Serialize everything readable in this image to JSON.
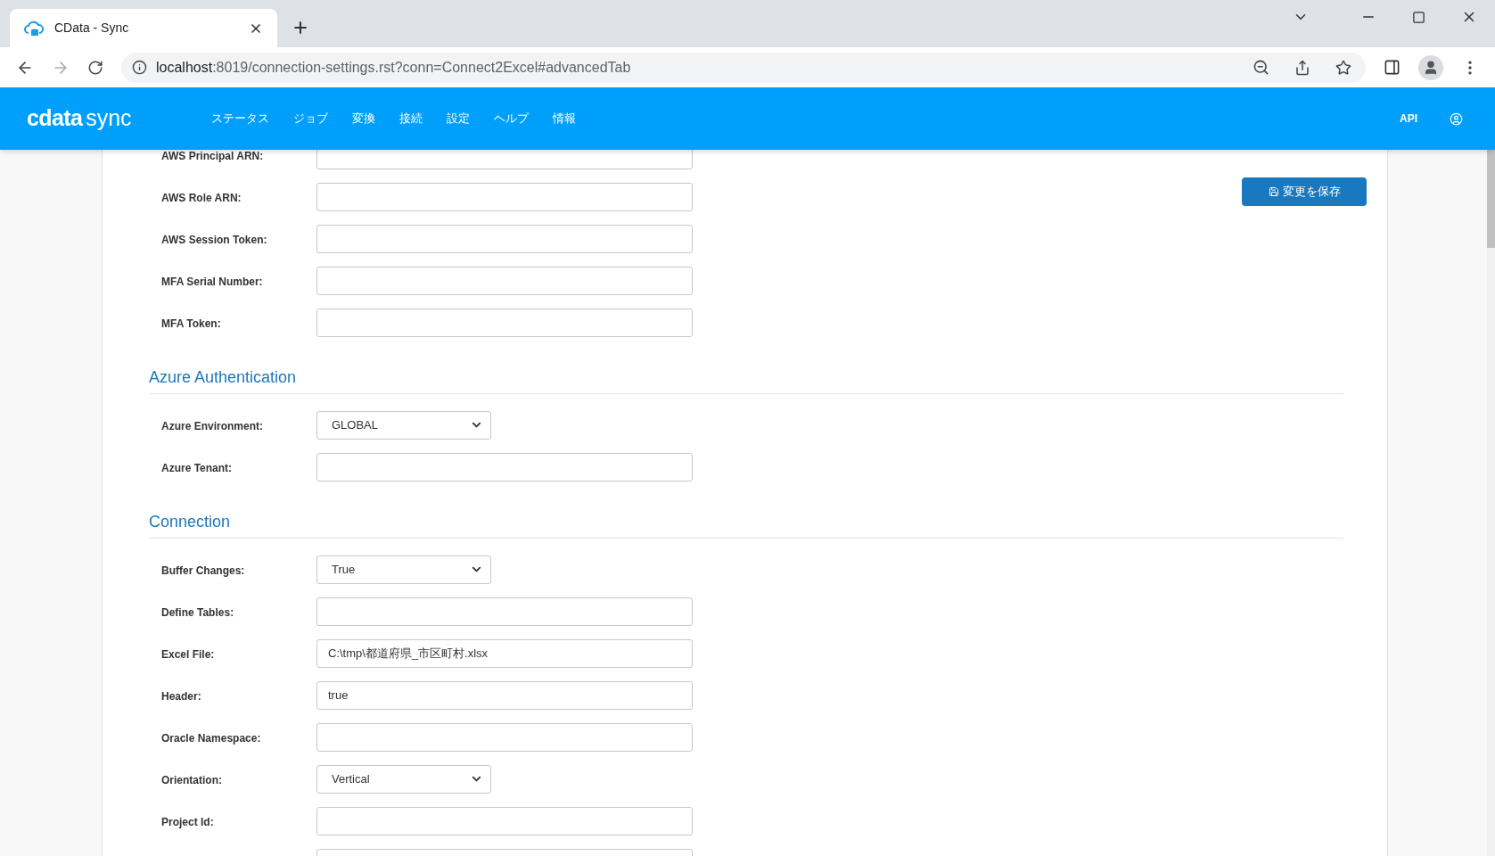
{
  "browser": {
    "tab_title": "CData - Sync",
    "url_host": "localhost",
    "url_rest": ":8019/connection-settings.rst?conn=Connect2Excel#advancedTab"
  },
  "logo": {
    "brand": "cdata",
    "product": "sync"
  },
  "nav": {
    "items": [
      {
        "label": "ステータス"
      },
      {
        "label": "ジョブ"
      },
      {
        "label": "変換"
      },
      {
        "label": "接続"
      },
      {
        "label": "設定"
      },
      {
        "label": "ヘルプ"
      },
      {
        "label": "情報"
      }
    ],
    "api_link": "API"
  },
  "save_button": "変更を保存",
  "sections": [
    {
      "fields": [
        {
          "label": "AWS Principal ARN:",
          "kind": "text"
        },
        {
          "label": "AWS Role ARN:",
          "kind": "text"
        },
        {
          "label": "AWS Session Token:",
          "kind": "text"
        },
        {
          "label": "MFA Serial Number:",
          "kind": "text"
        },
        {
          "label": "MFA Token:",
          "kind": "text"
        }
      ]
    },
    {
      "heading": "Azure Authentication",
      "fields": [
        {
          "label": "Azure Environment:",
          "kind": "select",
          "value": "GLOBAL"
        },
        {
          "label": "Azure Tenant:",
          "kind": "text"
        }
      ]
    },
    {
      "heading": "Connection",
      "fields": [
        {
          "label": "Buffer Changes:",
          "kind": "select",
          "value": "True"
        },
        {
          "label": "Define Tables:",
          "kind": "text"
        },
        {
          "label": "Excel File:",
          "kind": "text",
          "value": "C:\\tmp\\都道府県_市区町村.xlsx"
        },
        {
          "label": "Header:",
          "kind": "text",
          "value": "true"
        },
        {
          "label": "Oracle Namespace:",
          "kind": "text"
        },
        {
          "label": "Orientation:",
          "kind": "select",
          "value": "Vertical"
        },
        {
          "label": "Project Id:",
          "kind": "text"
        },
        {
          "kind": "text"
        }
      ]
    }
  ]
}
